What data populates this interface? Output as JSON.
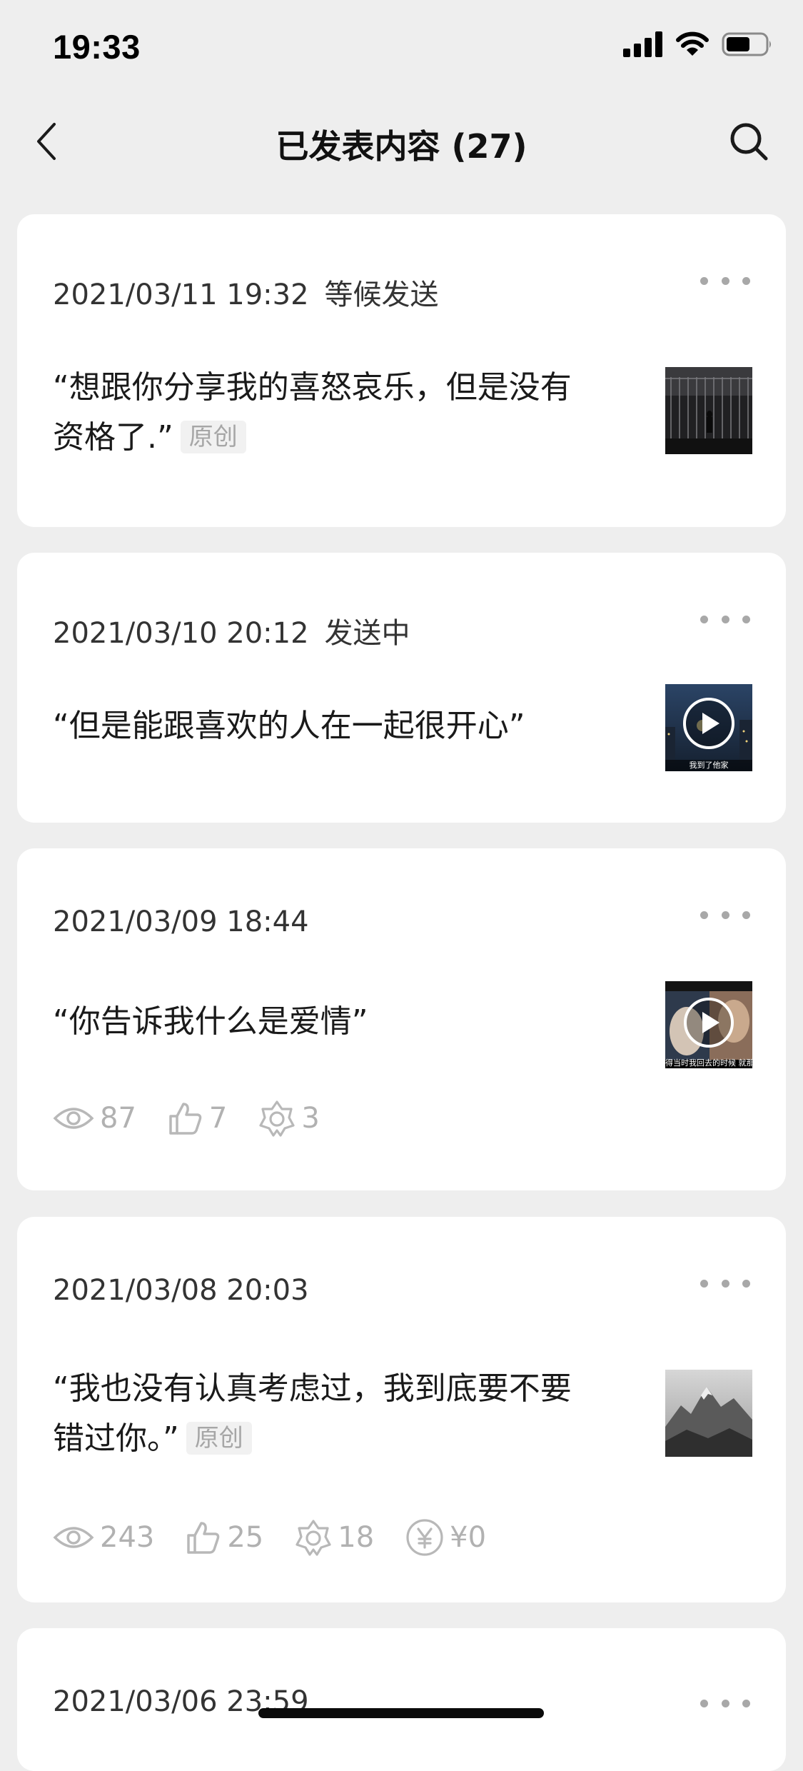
{
  "status_bar": {
    "time": "19:33"
  },
  "nav": {
    "title": "已发表内容 (27)"
  },
  "posts": [
    {
      "date": "2021/03/11 19:32",
      "status": "等候发送",
      "text": "“想跟你分享我的喜怒哀乐，但是没有资格了.”",
      "tag": "原创",
      "thumbnail": "silhouette-photo"
    },
    {
      "date": "2021/03/10 20:12",
      "status": "发送中",
      "text": "“但是能跟喜欢的人在一起很开心”",
      "thumbnail": "video-thumbnail",
      "thumbnail_caption": "我到了他家"
    },
    {
      "date": "2021/03/09 18:44",
      "status": "",
      "text": "“你告诉我什么是爱情”",
      "thumbnail": "video-thumbnail",
      "thumbnail_caption": "得当时我回去的时候 就那个",
      "stats": {
        "views": "87",
        "likes": "7",
        "shares": "3"
      }
    },
    {
      "date": "2021/03/08 20:03",
      "status": "",
      "text": "“我也没有认真考虑过，我到底要不要错过你。”",
      "tag": "原创",
      "thumbnail": "mountain-photo",
      "stats": {
        "views": "243",
        "likes": "25",
        "shares": "18",
        "reward": "¥0"
      }
    },
    {
      "date": "2021/03/06 23:59"
    }
  ]
}
